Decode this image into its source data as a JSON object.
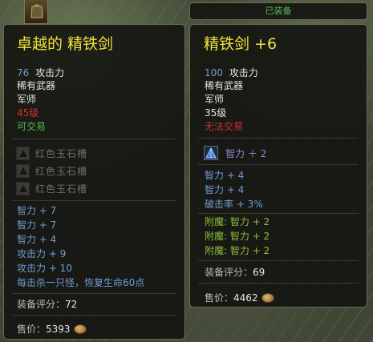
{
  "equipped_tab": "已装备",
  "left": {
    "title": "卓越的 精铁剑",
    "attack_value": "76",
    "attack_label": "攻击力",
    "rarity": "稀有武器",
    "class": "军师",
    "level": "45级",
    "tradable": "可交易",
    "gem_slots": [
      "红色玉石槽",
      "红色玉石槽",
      "红色玉石槽"
    ],
    "bonuses": [
      "智力 + 7",
      "智力 + 7",
      "智力 + 4",
      "攻击力 + 9",
      "攻击力 + 10",
      "每击杀一只怪，恢复生命60点"
    ],
    "score_label": "装备评分：",
    "score_value": "72",
    "price_label": "售价：",
    "price_value": "5393"
  },
  "right": {
    "title": "精铁剑 +6",
    "attack_value": "100",
    "attack_label": "攻击力",
    "rarity": "稀有武器",
    "class": "军师",
    "level": "35级",
    "tradable": "无法交易",
    "gem_stat": "智力 ＋ 2",
    "bonuses": [
      "智力 + 4",
      "智力 + 4",
      "破击率 + 3%"
    ],
    "enchants": [
      "附魔: 智力 + 2",
      "附魔: 智力 + 2",
      "附魔: 智力 + 2"
    ],
    "score_label": "装备评分：",
    "score_value": "69",
    "price_label": "售价：",
    "price_value": "4462"
  },
  "icons": {
    "corner": "bag-icon",
    "coin": "coin-icon",
    "slot": "empty-gem-slot-icon",
    "gem": "blue-gem-icon"
  },
  "colors": {
    "title": "#f0e23a",
    "stat_blue": "#6f9dd6",
    "red": "#d0302a",
    "green": "#4fb84f",
    "enchant_green": "#8cbf3a",
    "purple": "#9a84d8"
  }
}
